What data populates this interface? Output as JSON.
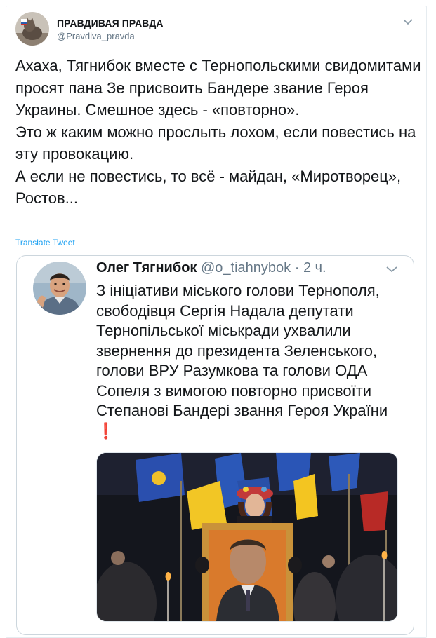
{
  "tweet": {
    "display_name": "ПРАВДИВАЯ ПРАВДА",
    "handle": "@Pravdiva_pravda",
    "lines": [
      "Ахаха, Тягнибок вместе с Тернопольскими свидомитами просят пана Зе присвоить Бандере звание Героя Украины.  Смешное здесь - «повторно».",
      "Это ж каким можно прослыть лохом, если повестись на эту провокацию.",
      "А если не повестись, то всё - майдан, «Миротворец», Ростов..."
    ],
    "translate_label": "Translate Tweet"
  },
  "quoted": {
    "display_name": "Олег Тягнибок",
    "handle": "@o_tiahnybok",
    "separator": "·",
    "time": "2 ч.",
    "text": "З ініціативи міського голови Тернополя, свободівця Сергія Надала депутати Тернопільської міськради ухвалили звернення до президента Зеленського, голови ВРУ Разумкова та голови ОДА Сопеля з вимогою повторно присвоїти Степанові Бандері звання Героя України",
    "emoji": "❗",
    "emoji_color": "#dd2e44"
  },
  "colors": {
    "link": "#1da1f2",
    "muted": "#657786",
    "border": "#ccd6dd"
  }
}
